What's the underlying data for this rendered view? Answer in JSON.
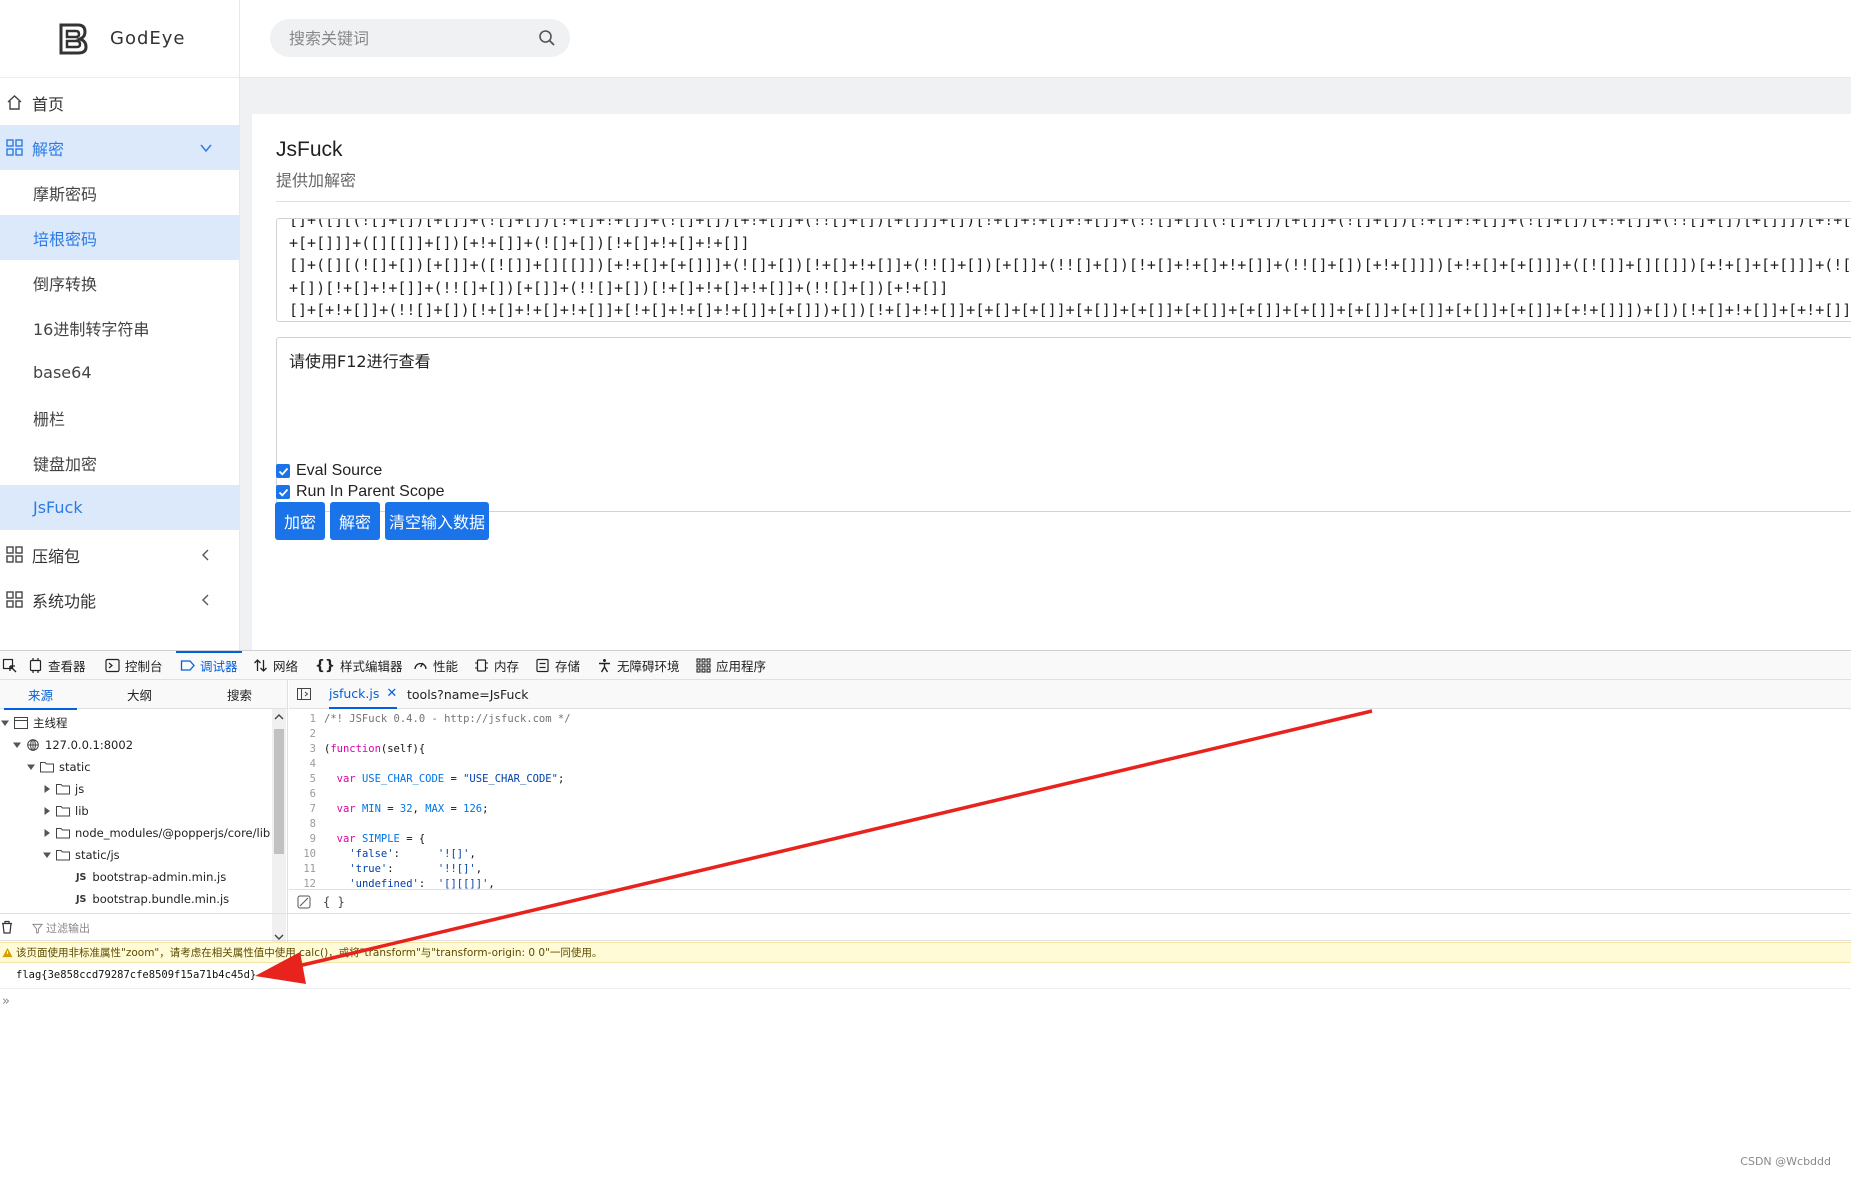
{
  "app": {
    "brand": "GodEye"
  },
  "search": {
    "placeholder": "搜索关键词"
  },
  "sidebar": {
    "home": "首页",
    "decrypt": "解密",
    "sub_items": [
      "摩斯密码",
      "培根密码",
      "倒序转换",
      "16进制转字符串",
      "base64",
      "栅栏",
      "键盘加密",
      "JsFuck"
    ],
    "compress": "压缩包",
    "system": "系统功能"
  },
  "card": {
    "title": "JsFuck",
    "subtitle": "提供加解密",
    "source_lines": [
      "[]+([][(![]+[])[+[]]+(![]+[])[!+[]+!+[]]+(![]+[])[+!+[]]+(!![]+[])[+[]]]+[])[!+[]+!+[]+!+[]]+(!![]+[][(![]+[])[+[]]+(![]+[])[!+[]+!+[]]+(![]+[])[+!+[]]+(!![]+[])[+[]]])[+!+[]+[+[]]]+([][[]]+[])[+!+[]]+(![]+[])[!+[]+!+[]+!+[]]",
      "[]+([][(![]+[])[+[]]+([![]]+[][[]])[+!+[]+[+[]]]+(![]+[])[!+[]+!+[]]+(!![]+[])[+[]]+(!![]+[])[!+[]+!+[]+!+[]]+(!![]+[])[+!+[]]])[+!+[]+[+[]]]+([![]]+[][[]])[+!+[]+[+[]]]+(![]+[])[!+[]+!+[]]+(!![]+[])[+[]]+(!![]+[])[!+[]+!+[]+!+[]]+(!![]+[])[+!+[]]",
      "[]+[+!+[]]+(!![]+[])[!+[]+!+[]+!+[]]+[!+[]+!+[]+!+[]]+[+[]])+[])[!+[]+!+[]]+[+[]+[+[]]+[+[]]+[+[]]+[+[]]+[+[]]+[+[]]+[+[]]+[+[]]+[+[]]+[+[]]+[+!+[]]])+[])[!+[]+!+[]]+[+!+[]])+([]+[])[([][(![]+[])[+[]]+([![]]+[][[]])[+!+[]+[+[]]]+(![]+[])[!+[]+!+[]]",
      "[+[]]+([][(![]+[])[+[]]+(![]+[])[!+[]+!+[]]+(!![]+[])[+[]]+(!![]+[])[+!+[]]+(![]+[])[+!+[]]+(!![]+[])[!+[]+!+[]+!+[]]+(![]+[])[+[]]])[+!+[]+[+[]]]+(!![]+[])[!+[]+!+[]+!+[]]+(!![]+[][(![]+[])[+[]]+([![]]+[][[]])[+!+[]+[+[]]]+(![]+[])[!+[]+!+[]]",
      "[!+[]+!+[]])[!+[]+!+[]+[+[]]]+(!![]+[])[+!+[]]]())[!+[]+!+[]+!+[]]+([+[]]+![]+[][(![]+[])[+[]]+([![]]+[][[]])[+!+[]+[+[]]]+(![]+[])[!+[]+!+[]]+(!![]+[])[+[]]+(!![]+[])[!+[]+!+[]+!+[]]+(!![]+[])[+!+[]]])[!+[]+!+[]+[+[]]])"
    ],
    "output": "请使用F12进行查看",
    "eval_source": "Eval Source",
    "parent_scope": "Run In Parent Scope",
    "btn_encrypt": "加密",
    "btn_decrypt": "解密",
    "btn_clear": "清空输入数据"
  },
  "devtools": {
    "tabs": [
      "查看器",
      "控制台",
      "调试器",
      "网络",
      "样式编辑器",
      "性能",
      "内存",
      "存储",
      "无障碍环境",
      "应用程序"
    ],
    "active_tab": "调试器",
    "source_tabs": [
      "来源",
      "大纲",
      "搜索"
    ],
    "tree": {
      "main_thread": "主线程",
      "host": "127.0.0.1:8002",
      "static": "static",
      "js": "js",
      "lib": "lib",
      "popper": "node_modules/@popperjs/core/lib",
      "static_js": "static/js",
      "file1": "bootstrap-admin.min.js",
      "file2": "bootstrap.bundle.min.js",
      "js_badge": "JS"
    },
    "editor_tabs": [
      "jsfuck.js",
      "tools?name=JsFuck"
    ],
    "code": {
      "l1": "/*! JSFuck 0.4.0 - http://jsfuck.com */",
      "l3_kw": "function",
      "l3_rest": "(self){",
      "l5_kw": "var ",
      "l5_var": "USE_CHAR_CODE",
      "l5_eq": " = ",
      "l5_str": "\"USE_CHAR_CODE\"",
      "l5_end": ";",
      "l7_kw": "var ",
      "l7_v1": "MIN",
      "l7_eq1": " = ",
      "l7_n1": "32",
      "l7_sep": ", ",
      "l7_v2": "MAX",
      "l7_eq2": " = ",
      "l7_n2": "126",
      "l7_end": ";",
      "l9_kw": "var ",
      "l9_var": "SIMPLE",
      "l9_end": " = {",
      "l10_k": "'false'",
      "l10_v": "'![]'",
      "l11_k": "'true'",
      "l11_v": "'!![]'",
      "l12_k": "'undefined'",
      "l12_v": "'[][[]]'"
    },
    "editor_footer": "{ }",
    "console_filter": "过滤输出",
    "warning": "该页面使用非标准属性\"zoom\"，请考虑在相关属性值中使用 calc()，或将\"transform\"与\"transform-origin: 0 0\"一同使用。",
    "flag": "flag{3e858ccd79287cfe8509f15a71b4c45d}",
    "prompt": "»"
  },
  "watermark": "CSDN @Wcbddd",
  "colors": {
    "accent": "#1a73e8",
    "arrow": "#e8231e"
  }
}
